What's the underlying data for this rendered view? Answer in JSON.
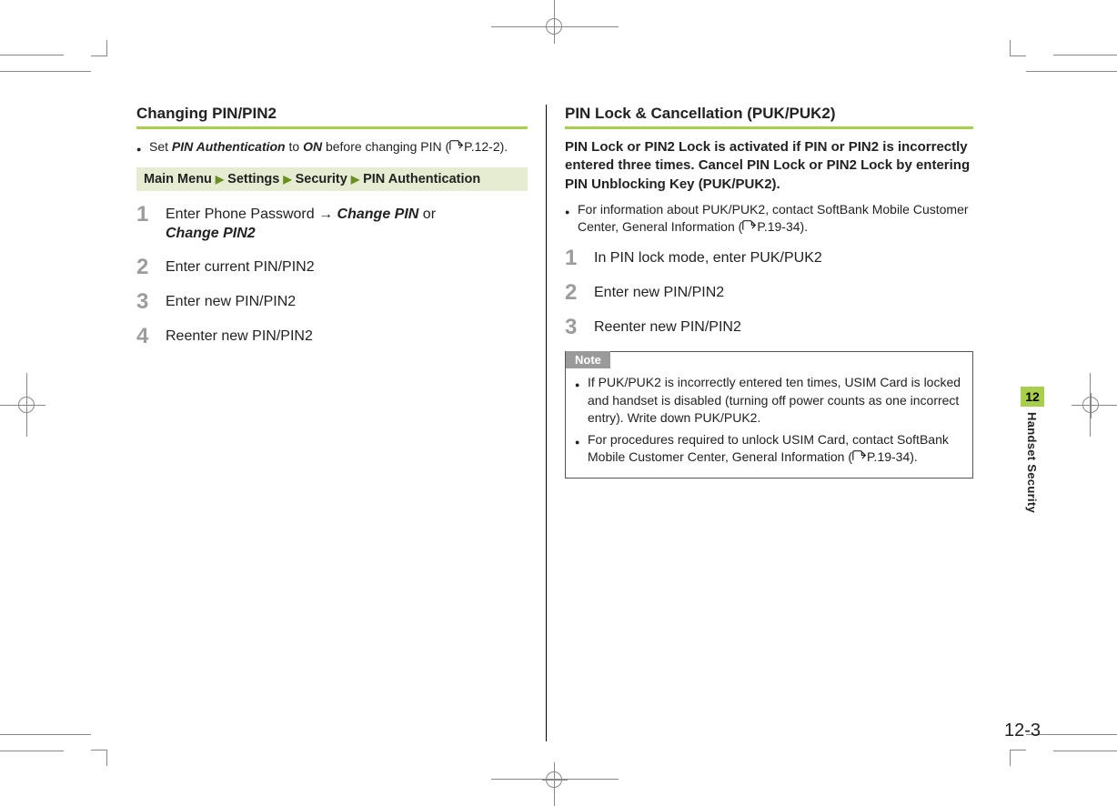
{
  "left": {
    "heading": "Changing PIN/PIN2",
    "pre_bullet_a": "Set ",
    "pre_bullet_b": "PIN Authentication",
    "pre_bullet_c": " to ",
    "pre_bullet_d": "ON",
    "pre_bullet_e": " before changing PIN (",
    "pre_bullet_f": "P.12-2).",
    "nav": [
      "Main Menu",
      "Settings",
      "Security",
      "PIN Authentication"
    ],
    "steps": [
      {
        "parts": [
          "Enter Phone Password ",
          "→",
          " ",
          "Change PIN",
          " or ",
          "Change PIN2"
        ],
        "boldItalic": [
          3,
          5
        ]
      },
      {
        "text": "Enter current PIN/PIN2"
      },
      {
        "text": "Enter new PIN/PIN2"
      },
      {
        "text": "Reenter new PIN/PIN2"
      }
    ]
  },
  "right": {
    "heading": "PIN Lock & Cancellation (PUK/PUK2)",
    "intro": "PIN Lock or PIN2 Lock is activated if PIN or PIN2 is incorrectly entered three times. Cancel PIN Lock or PIN2 Lock by entering PIN Unblocking Key (PUK/PUK2).",
    "bullet_a": "For information about PUK/PUK2, contact SoftBank Mobile Customer Center, General Information (",
    "bullet_b": "P.19-34).",
    "steps": [
      {
        "text": "In PIN lock mode, enter PUK/PUK2"
      },
      {
        "text": "Enter new PIN/PIN2"
      },
      {
        "text": "Reenter new PIN/PIN2"
      }
    ],
    "note_label": "Note",
    "note1": "If PUK/PUK2 is incorrectly entered ten times, USIM Card is locked and handset is disabled (turning off power counts as one incorrect entry). Write down PUK/PUK2.",
    "note2_a": "For procedures required to unlock USIM Card, contact SoftBank Mobile Customer Center, General Information (",
    "note2_b": "P.19-34)."
  },
  "side": {
    "chapter": "12",
    "title": "Handset Security"
  },
  "page_number": "12-3"
}
